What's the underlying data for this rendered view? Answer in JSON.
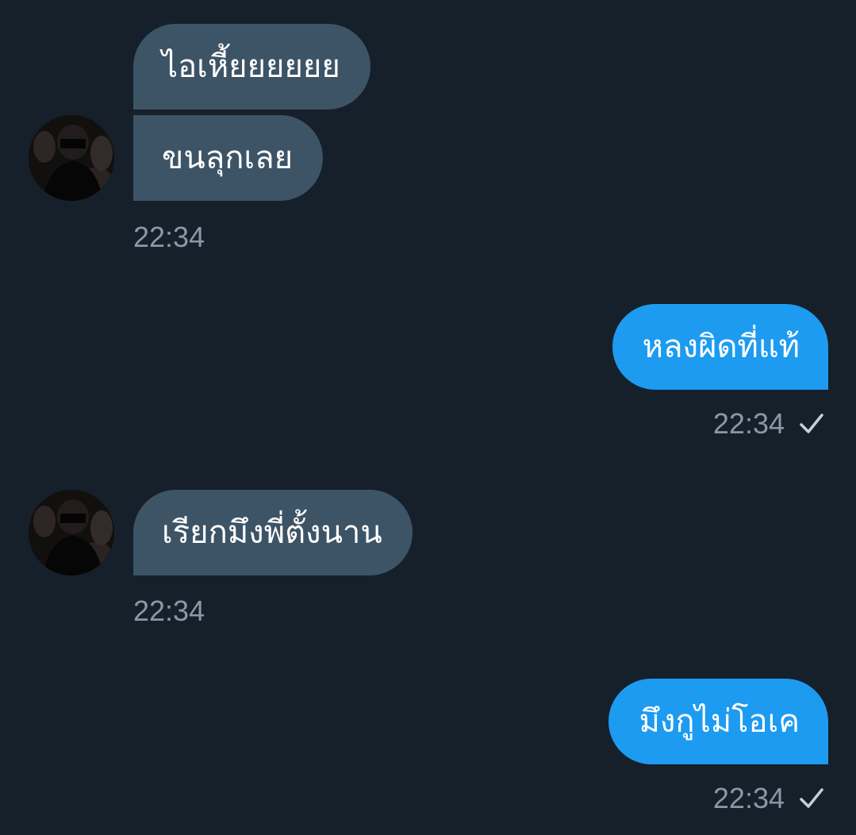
{
  "messages": [
    {
      "id": "m1",
      "direction": "incoming",
      "text": "ไอเหี้ยยยยยย"
    },
    {
      "id": "m2",
      "direction": "incoming",
      "text": "ขนลุกเลย",
      "time": "22:34"
    },
    {
      "id": "m3",
      "direction": "outgoing",
      "text": "หลงผิดที่แท้",
      "time": "22:34",
      "status_icon": "checkmark-icon"
    },
    {
      "id": "m4",
      "direction": "incoming",
      "text": "เรียกมึงพี่ตั้งนาน",
      "time": "22:34"
    },
    {
      "id": "m5",
      "direction": "outgoing",
      "text": "มึงกูไม่โอเค",
      "time": "22:34",
      "status_icon": "checkmark-icon"
    }
  ],
  "colors": {
    "background": "#15202b",
    "incoming_bubble": "#3d5466",
    "outgoing_bubble": "#1d9bf0",
    "timestamp": "#8899a6",
    "text": "#ffffff"
  },
  "icons": {
    "avatar": "avatar-photo-icon",
    "sent_status": "checkmark-icon"
  }
}
